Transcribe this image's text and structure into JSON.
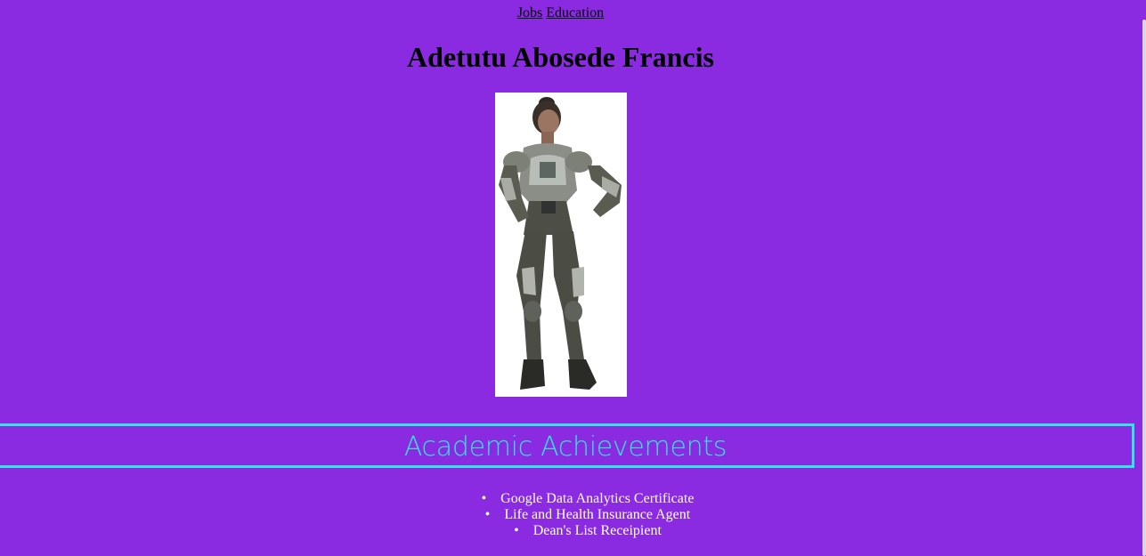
{
  "nav": {
    "jobs_label": "Jobs",
    "education_label": "Education"
  },
  "header": {
    "title": "Adetutu Abosede Francis"
  },
  "section": {
    "heading": "Academic Achievements",
    "items": [
      "Google Data Analytics Certificate",
      "Life and Health Insurance Agent",
      "Dean's List Receipient"
    ]
  },
  "colors": {
    "background": "#8a2be2",
    "accent": "#30e6e6",
    "list_text": "#ffffff"
  },
  "icons": {
    "portrait": "profile-photo"
  }
}
